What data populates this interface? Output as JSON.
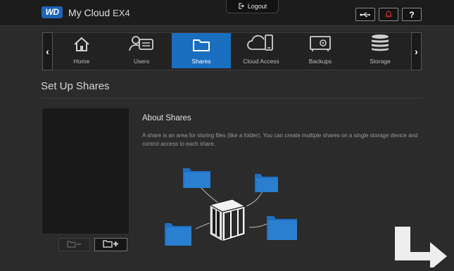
{
  "header": {
    "logo_text": "WD",
    "brand": "My Cloud",
    "model": "EX4",
    "logout_label": "Logout",
    "buttons": [
      {
        "name": "usb-icon"
      },
      {
        "name": "alert-bell-icon",
        "color": "#d62f2f"
      },
      {
        "name": "help-icon",
        "label": "?"
      }
    ]
  },
  "nav": {
    "prev_label": "‹",
    "next_label": "›",
    "items": [
      {
        "label": "Home",
        "icon": "home-icon",
        "active": false
      },
      {
        "label": "Users",
        "icon": "users-icon",
        "active": false
      },
      {
        "label": "Shares",
        "icon": "folder-icon",
        "active": true
      },
      {
        "label": "Cloud Access",
        "icon": "cloud-access-icon",
        "active": false
      },
      {
        "label": "Backups",
        "icon": "safe-icon",
        "active": false
      },
      {
        "label": "Storage",
        "icon": "storage-icon",
        "active": false
      }
    ]
  },
  "page": {
    "title": "Set Up Shares",
    "about_title": "About Shares",
    "about_text": "A share is an area for storing files (like a folder). You can create multiple shares on a single storage device and control access to each share."
  },
  "colors": {
    "accent": "#1a6ec0",
    "folder": "#1f6fc0",
    "watermark": "#ffffff"
  }
}
